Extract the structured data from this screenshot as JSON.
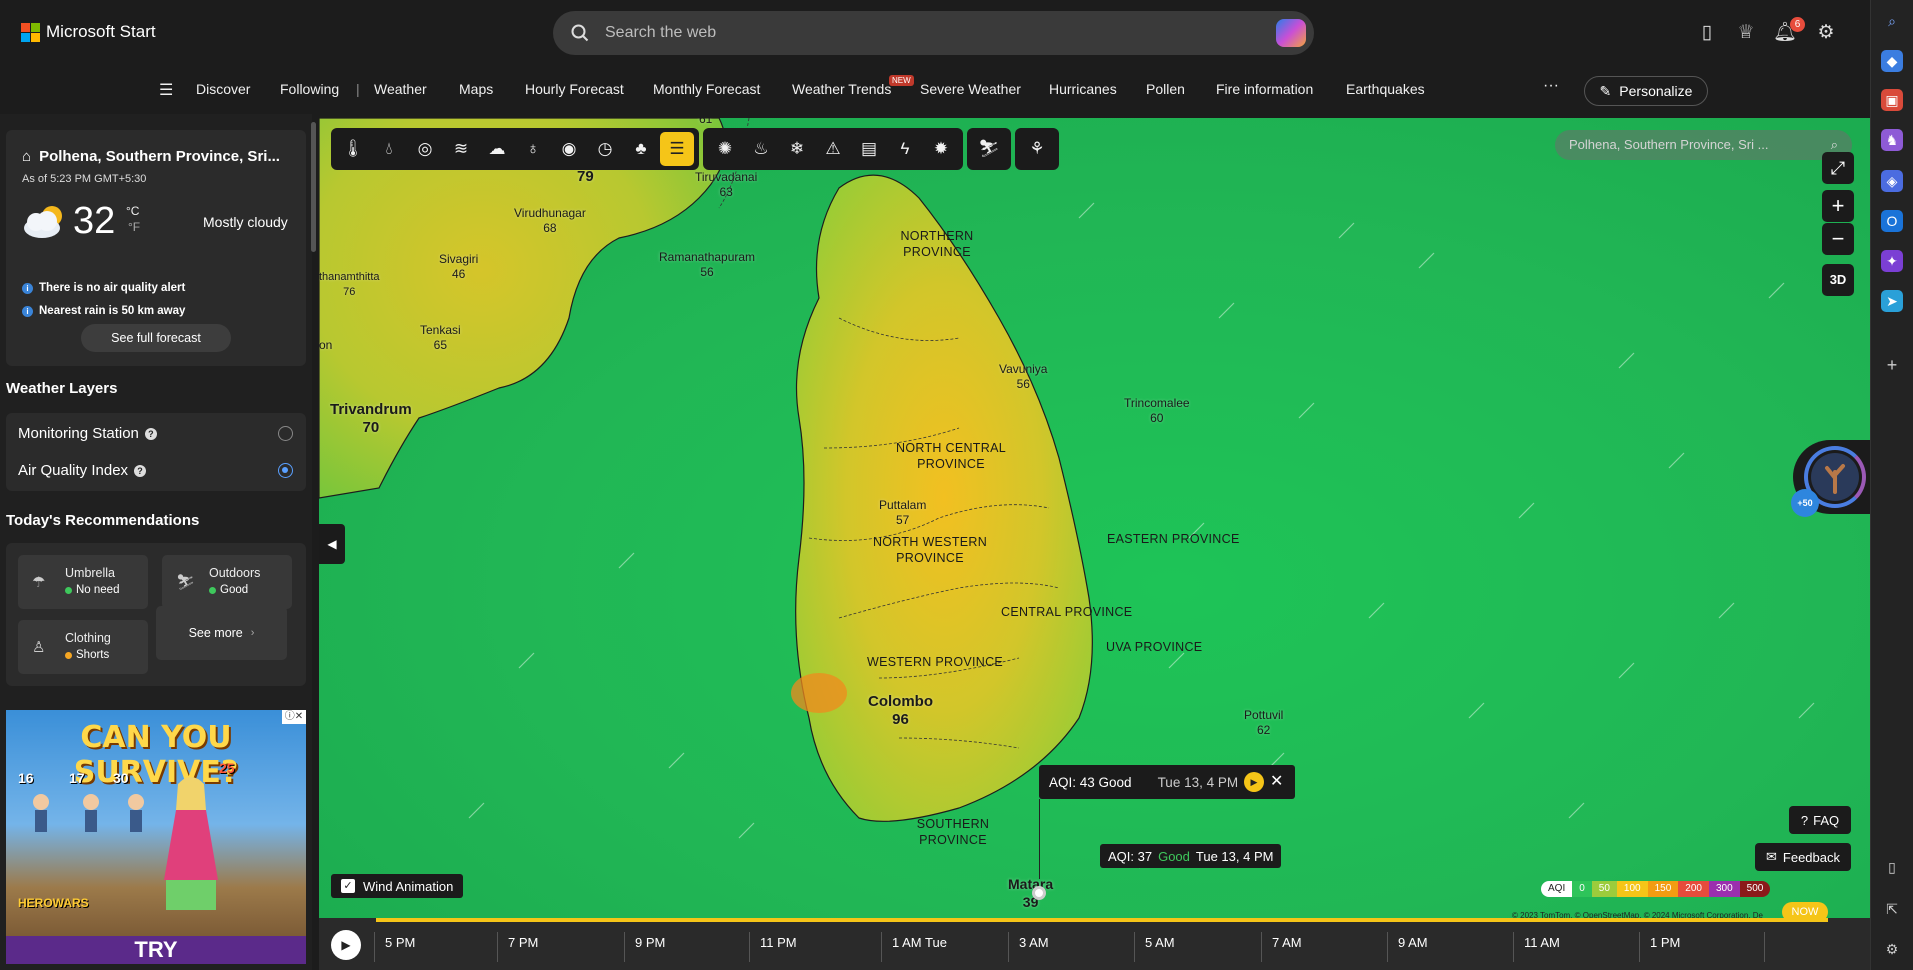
{
  "header": {
    "brand": "Microsoft Start",
    "search_placeholder": "Search the web",
    "notification_count": "6"
  },
  "nav": {
    "items": [
      "Discover",
      "Following",
      "Weather",
      "Maps",
      "Hourly Forecast",
      "Monthly Forecast",
      "Weather Trends",
      "Severe Weather",
      "Hurricanes",
      "Pollen",
      "Fire information",
      "Earthquakes"
    ],
    "new_tag": "NEW",
    "more": "···",
    "personalize": "Personalize"
  },
  "weather": {
    "location": "Polhena, Southern Province, Sri...",
    "as_of": "As of 5:23 PM GMT+5:30",
    "temperature": "32",
    "unit_c": "°C",
    "unit_f": "°F",
    "condition": "Mostly cloudy",
    "alerts": [
      "There is no air quality alert",
      "Nearest rain is 50 km away"
    ],
    "forecast_button": "See full forecast"
  },
  "layers": {
    "title": "Weather Layers",
    "items": [
      {
        "label": "Monitoring Station",
        "selected": false
      },
      {
        "label": "Air Quality Index",
        "selected": true
      }
    ]
  },
  "recommendations": {
    "title": "Today's Recommendations",
    "items": [
      {
        "label": "Umbrella",
        "value": "No need",
        "color": "#3ec85c",
        "icon": "umbrella-icon"
      },
      {
        "label": "Outdoors",
        "value": "Good",
        "color": "#3ec85c",
        "icon": "outdoors-icon"
      },
      {
        "label": "Clothing",
        "value": "Shorts",
        "color": "#f5a623",
        "icon": "clothing-icon"
      }
    ],
    "see_more": "See more"
  },
  "ad": {
    "title": "CAN YOU SURVIVE?",
    "numbers": [
      "16",
      "17",
      "30",
      "25"
    ],
    "logo": "HEROWARS",
    "cta": "TRY"
  },
  "map": {
    "search_placeholder": "Polhena, Southern Province, Sri ...",
    "btn_3d": "3D",
    "points_badge": "+50",
    "cities": [
      {
        "name": "",
        "aqi": "61"
      },
      {
        "name": "",
        "aqi": "79"
      },
      {
        "name": "Tiruvadanai",
        "aqi": "63"
      },
      {
        "name": "Virudhunagar",
        "aqi": "68"
      },
      {
        "name": "Sivagiri",
        "aqi": "46"
      },
      {
        "name": "Ramanathapuram",
        "aqi": "56"
      },
      {
        "name": "thanamthitta",
        "aqi": "76"
      },
      {
        "name": "Tenkasi",
        "aqi": "65"
      },
      {
        "name": "on",
        "aqi": ""
      },
      {
        "name": "Trivandrum",
        "aqi": "70"
      },
      {
        "name": "Vavuniya",
        "aqi": "56"
      },
      {
        "name": "Trincomalee",
        "aqi": "60"
      },
      {
        "name": "Puttalam",
        "aqi": "57"
      },
      {
        "name": "Colombo",
        "aqi": "96"
      },
      {
        "name": "Pottuvil",
        "aqi": "62"
      },
      {
        "name": "Matara",
        "aqi": "39"
      }
    ],
    "provinces": [
      "NORTHERN PROVINCE",
      "NORTH CENTRAL PROVINCE",
      "NORTH WESTERN PROVINCE",
      "EASTERN PROVINCE",
      "CENTRAL PROVINCE",
      "UVA PROVINCE",
      "WESTERN PROVINCE",
      "SOUTHERN PROVINCE"
    ],
    "tooltip": {
      "aqi": "AQI: 43 Good",
      "time": "Tue 13, 4 PM"
    },
    "aqi_label": {
      "prefix": "AQI: 37",
      "status": "Good",
      "time": "Tue 13, 4 PM"
    },
    "faq": "FAQ",
    "feedback": "Feedback",
    "wind_animation": "Wind Animation",
    "legend": {
      "label": "AQI",
      "stops": [
        {
          "value": "0",
          "color": "#2ec45a"
        },
        {
          "value": "50",
          "color": "#9ccc3c"
        },
        {
          "value": "100",
          "color": "#f5c518"
        },
        {
          "value": "150",
          "color": "#f39c12"
        },
        {
          "value": "200",
          "color": "#e74c3c"
        },
        {
          "value": "300",
          "color": "#9b2fae"
        },
        {
          "value": "500",
          "color": "#8b1a1a"
        }
      ]
    },
    "copyright": "© 2023 TomTom, © OpenStreetMap, © 2024 Microsoft Corporation, De",
    "now": "NOW",
    "timeline": [
      "5 PM",
      "7 PM",
      "9 PM",
      "11 PM",
      "1 AM Tue",
      "3 AM",
      "5 AM",
      "7 AM",
      "9 AM",
      "11 AM",
      "1 PM"
    ]
  }
}
